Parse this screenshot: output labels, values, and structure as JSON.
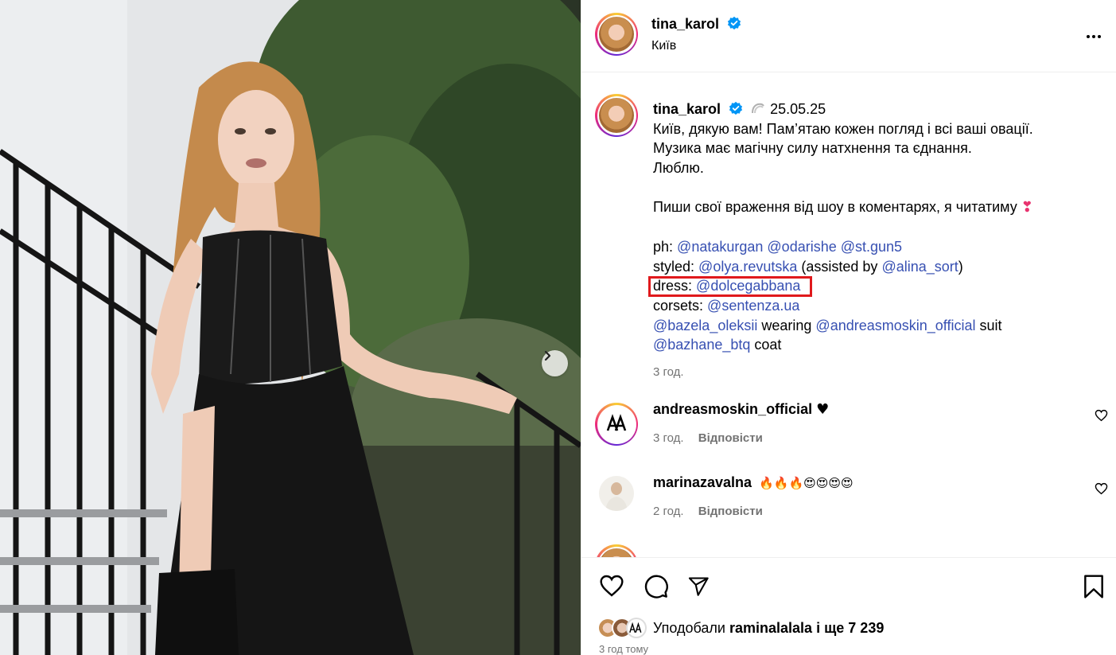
{
  "post": {
    "username": "tina_karol",
    "location": "Київ",
    "date": "25.05.25",
    "caption_lines": [
      "Київ, дякую вам! Пам’ятаю кожен погляд і всі ваші овації.",
      "Музика має магічну силу натхнення та єднання.",
      "Люблю.",
      "",
      "Пиши свої враження від шоу в коментарях, я читатиму"
    ],
    "caption_heart": "❣",
    "credits": {
      "ph_label": "ph:",
      "ph_mentions": [
        "@natakurgan",
        "@odarishe",
        "@st.gun5"
      ],
      "styled_label": "styled:",
      "styled_mention": "@olya.revutska",
      "assisted_pre": "(assisted by",
      "assisted_mention": "@alina_sort",
      "assisted_post": ")",
      "dress_label": "dress:",
      "dress_mention": "@dolcegabbana",
      "corsets_label": "corsets:",
      "corsets_mention": "@sentenza.ua",
      "wearing_mention1": "@bazela_oleksii",
      "wearing_text": "wearing",
      "wearing_mention2": "@andreasmoskin_official",
      "wearing_suffix": "suit",
      "coat_mention": "@bazhane_btq",
      "coat_text": "coat"
    },
    "time_ago": "3 год."
  },
  "comments": [
    {
      "username": "andreasmoskin_official",
      "text": "♥",
      "time": "3 год.",
      "reply": "Відповісти"
    },
    {
      "username": "marinazavalna",
      "text": "🔥🔥🔥😍😍😍😍",
      "time": "2 год.",
      "reply": "Відповісти"
    }
  ],
  "actions": {
    "likes_prefix": "Уподобали",
    "likes_user": "raminalalala",
    "likes_and": "і",
    "likes_count": "ще 7 239",
    "posted_ago": "3 год тому"
  },
  "colors": {
    "mention": "#3750b2",
    "highlight": "#e0191c",
    "verified": "#0095f6",
    "muted": "#737373"
  }
}
